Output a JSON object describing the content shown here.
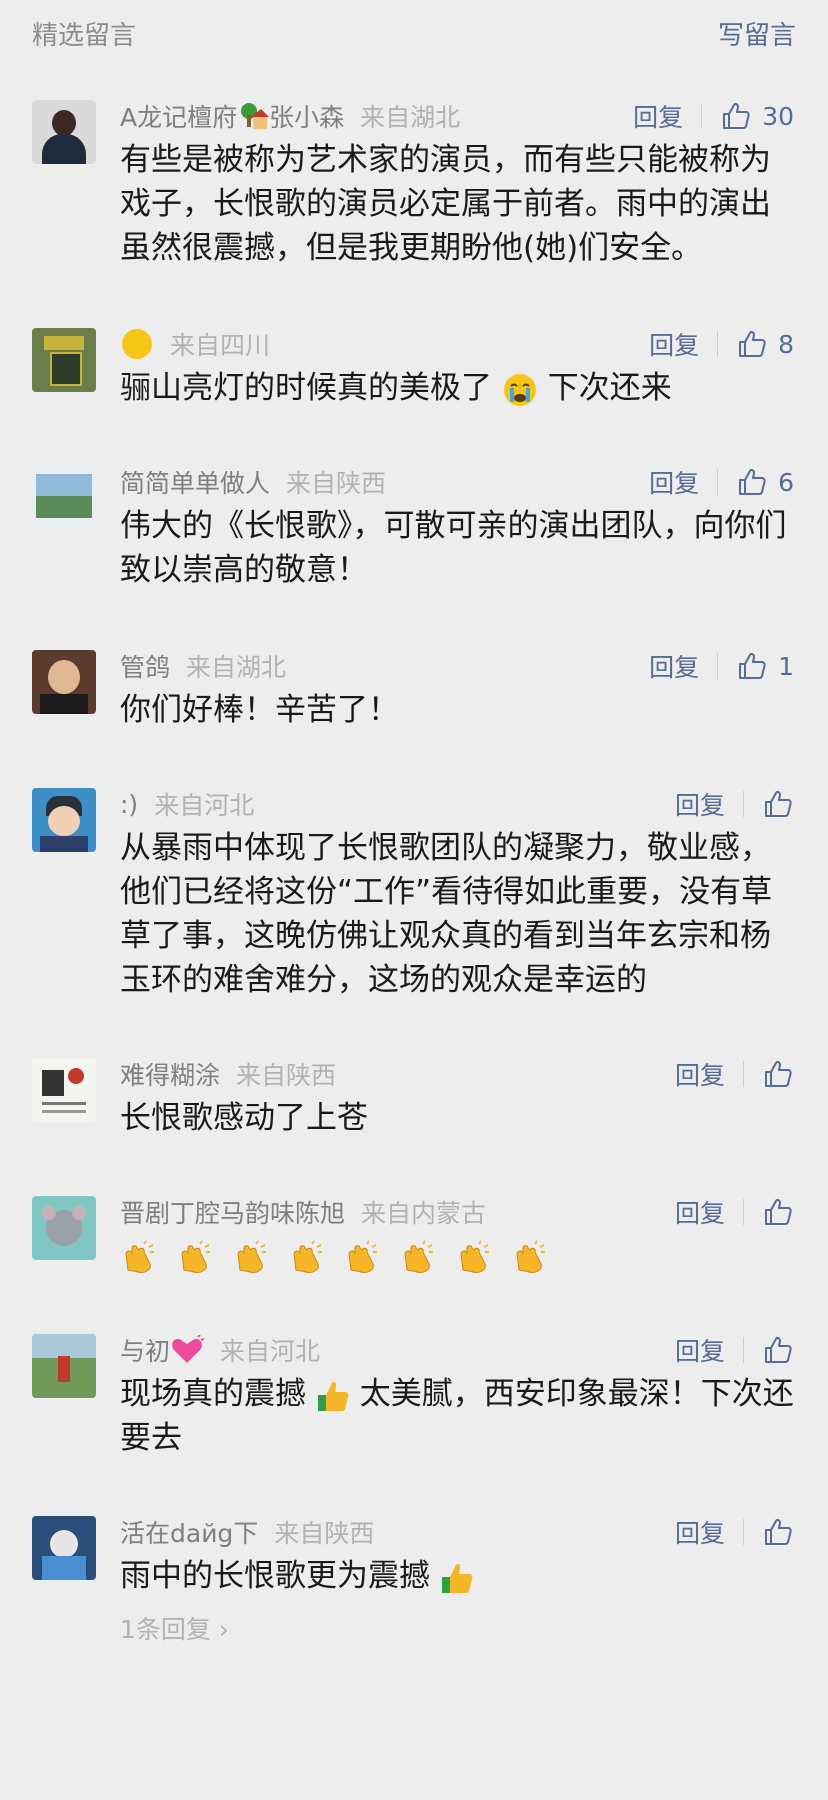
{
  "header": {
    "title": "精选留言",
    "write_label": "写留言"
  },
  "comments": [
    {
      "nick": "A龙记檀府",
      "nick2": "张小森",
      "from": "来自湖北",
      "reply": "回复",
      "likes": "30",
      "text": "有些是被称为艺术家的演员，而有些只能被称为戏子，长恨歌的演员必定属于前者。雨中的演出虽然很震撼，但是我更期盼他(她)们安全。"
    },
    {
      "nick": "",
      "from": "来自四川",
      "reply": "回复",
      "likes": "8",
      "text": "骊山亮灯的时候真的美极了",
      "text2": "下次还来"
    },
    {
      "nick": "简简单单做人",
      "from": "来自陕西",
      "reply": "回复",
      "likes": "6",
      "text": "伟大的《长恨歌》，可散可亲的演出团队，向你们致以崇高的敬意！"
    },
    {
      "nick": "管鸽",
      "from": "来自湖北",
      "reply": "回复",
      "likes": "1",
      "text": "你们好棒！辛苦了！"
    },
    {
      "nick": ":)",
      "from": "来自河北",
      "reply": "回复",
      "likes": "",
      "text": "从暴雨中体现了长恨歌团队的凝聚力，敬业感，他们已经将这份“工作”看待得如此重要，没有草草了事，这晚仿佛让观众真的看到当年玄宗和杨玉环的难舍难分，这场的观众是幸运的"
    },
    {
      "nick": "难得糊涂",
      "from": "来自陕西",
      "reply": "回复",
      "likes": "",
      "text": "长恨歌感动了上苍"
    },
    {
      "nick": "晋剧丁腔马韵味陈旭",
      "from": "来自内蒙古",
      "reply": "回复",
      "likes": "",
      "text": ""
    },
    {
      "nick": "与初",
      "from": "来自河北",
      "reply": "回复",
      "likes": "",
      "text": "现场真的震撼",
      "text2": "太美腻，西安印象最深！下次还要去"
    },
    {
      "nick": "活在daйg下",
      "from": "来自陕西",
      "reply": "回复",
      "likes": "",
      "text": "雨中的长恨歌更为震撼",
      "replies": "1条回复"
    }
  ],
  "icons": {
    "like": "thumbs-up-icon",
    "crying": "crying-face-emoji",
    "clap": "clapping-hands-emoji",
    "thumb": "thumbs-up-emoji",
    "heart": "sparkling-heart-emoji",
    "house": "house-emoji",
    "moon": "yellow-circle-emoji"
  },
  "colors": {
    "link": "#576b95",
    "meta": "#7f7f7f",
    "muted": "#b2b2b2",
    "bg": "#ededed"
  }
}
